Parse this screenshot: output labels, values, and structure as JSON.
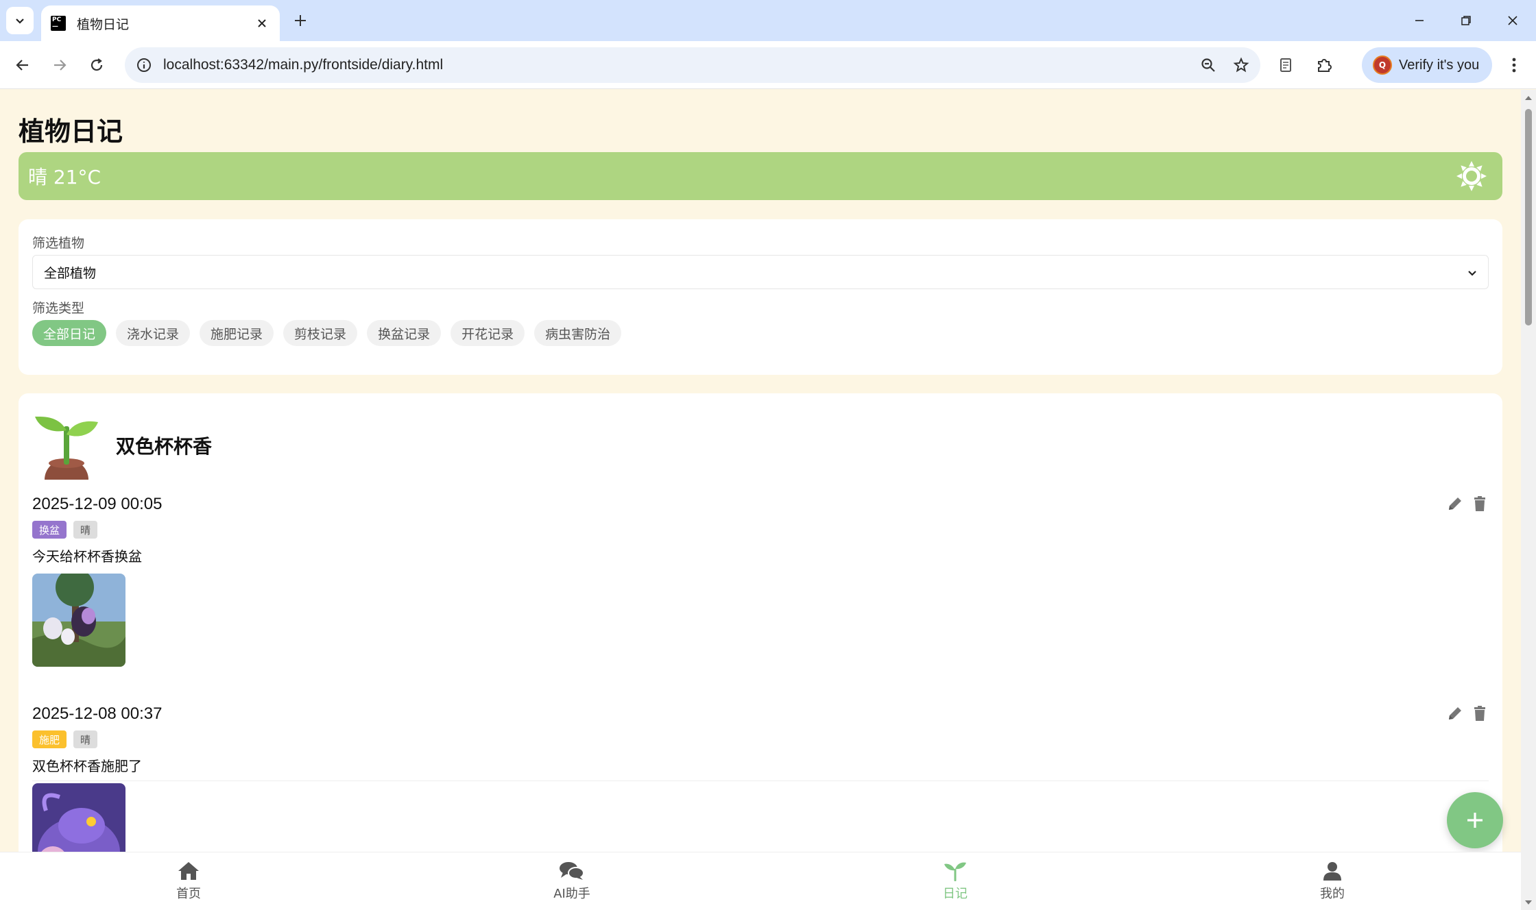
{
  "browser": {
    "tab_title": "植物日记",
    "url": "localhost:63342/main.py/frontside/diary.html",
    "verify_label": "Verify it's you",
    "verify_avatar_letter": "Q"
  },
  "page": {
    "title": "植物日记",
    "weather_text": "晴 21°C"
  },
  "filters": {
    "plant_label": "筛选植物",
    "plant_selected": "全部植物",
    "type_label": "筛选类型",
    "chips": [
      {
        "label": "全部日记",
        "active": true
      },
      {
        "label": "浇水记录",
        "active": false
      },
      {
        "label": "施肥记录",
        "active": false
      },
      {
        "label": "剪枝记录",
        "active": false
      },
      {
        "label": "换盆记录",
        "active": false
      },
      {
        "label": "开花记录",
        "active": false
      },
      {
        "label": "病虫害防治",
        "active": false
      }
    ]
  },
  "plant": {
    "name": "双色杯杯香",
    "entries": [
      {
        "date": "2025-12-09 00:05",
        "type_tag": "换盆",
        "type_color": "#9575cd",
        "weather_tag": "晴",
        "content": "今天给杯杯香换盆"
      },
      {
        "date": "2025-12-08 00:37",
        "type_tag": "施肥",
        "type_color": "#fbc02d",
        "weather_tag": "晴",
        "content": "双色杯杯香施肥了"
      }
    ]
  },
  "bottom_nav": [
    {
      "label": "首页",
      "icon": "home-icon",
      "active": false
    },
    {
      "label": "AI助手",
      "icon": "chat-icon",
      "active": false
    },
    {
      "label": "日记",
      "icon": "sprout-icon",
      "active": true
    },
    {
      "label": "我的",
      "icon": "user-icon",
      "active": false
    }
  ],
  "colors": {
    "accent_green": "#81c784",
    "weather_bar": "#aed581",
    "page_bg": "#fdf6e3"
  }
}
